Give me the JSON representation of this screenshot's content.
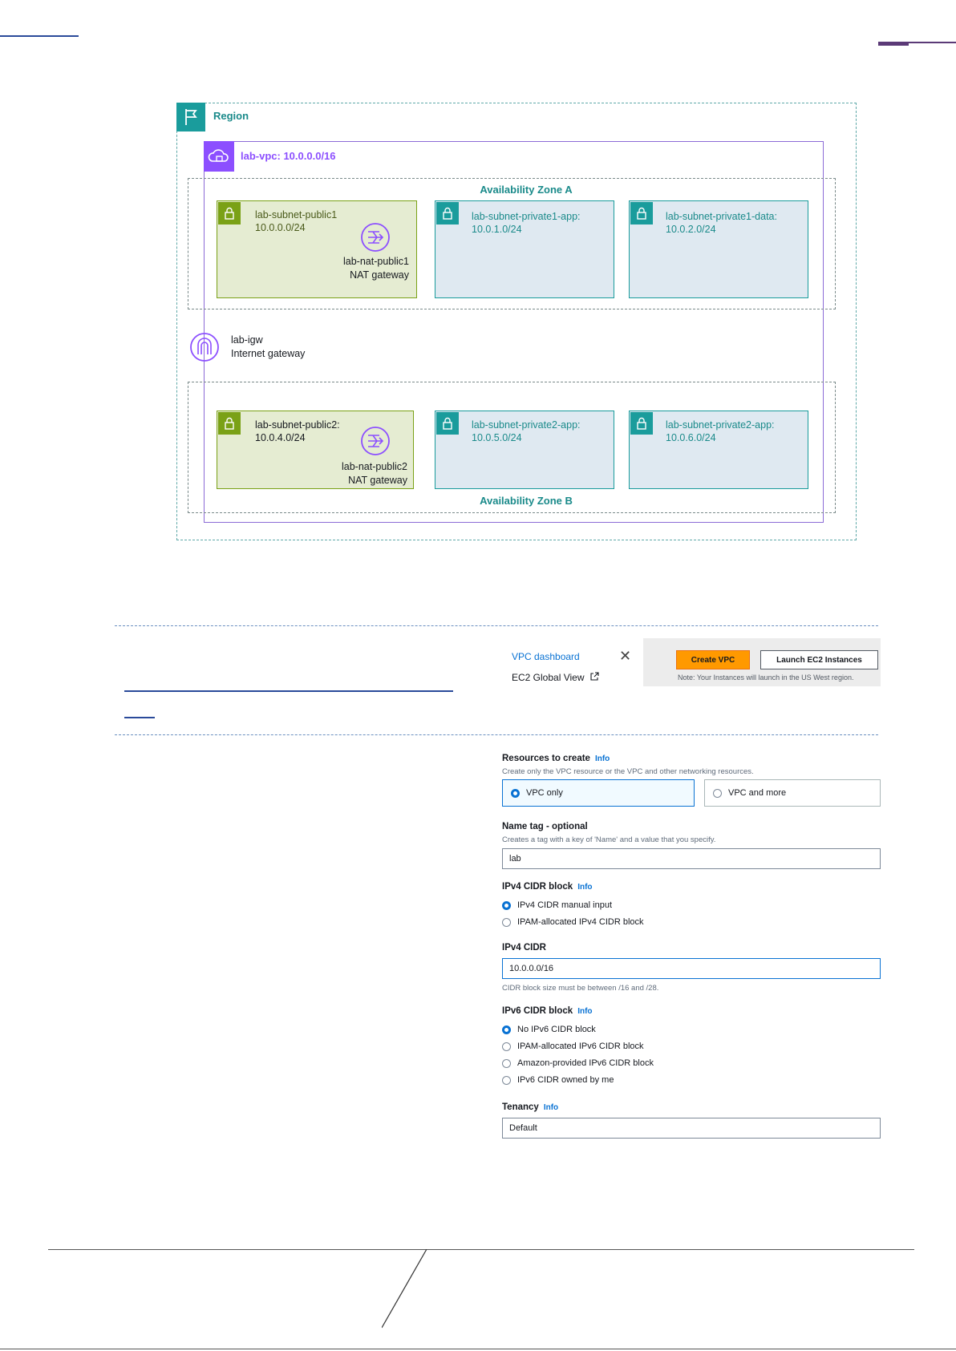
{
  "diagram": {
    "region_label": "Region",
    "vpc_label": "lab-vpc: 10.0.0.0/16",
    "az_a_label": "Availability Zone A",
    "az_b_label": "Availability Zone B",
    "igw": {
      "name": "lab-igw",
      "type": "Internet gateway"
    },
    "zone_a_subnets": [
      {
        "name": "lab-subnet-public1",
        "cidr": "10.0.0.0/24",
        "nat_name": "lab-nat-public1",
        "nat_type": "NAT gateway"
      },
      {
        "name": "lab-subnet-private1-app:",
        "cidr": "10.0.1.0/24"
      },
      {
        "name": "lab-subnet-private1-data:",
        "cidr": "10.0.2.0/24"
      }
    ],
    "zone_b_subnets": [
      {
        "name": "lab-subnet-public2:",
        "cidr": "10.0.4.0/24",
        "nat_name": "lab-nat-public2",
        "nat_type": "NAT gateway"
      },
      {
        "name": "lab-subnet-private2-app:",
        "cidr": "10.0.5.0/24"
      },
      {
        "name": "lab-subnet-private2-app:",
        "cidr": "10.0.6.0/24"
      }
    ],
    "colors": {
      "region": "#1a9c9c",
      "vpc": "#8c4fff",
      "public": "#7aa116",
      "private": "#1a9c9c"
    }
  },
  "nav": {
    "vpc_dashboard": "VPC dashboard",
    "ec2_global_view": "EC2 Global View",
    "close_icon": "close-icon",
    "create_vpc": "Create VPC",
    "launch_ec2": "Launch EC2 Instances",
    "note": "Note: Your Instances will launch in the US West region."
  },
  "form": {
    "resources": {
      "label": "Resources to create",
      "info": "Info",
      "desc": "Create only the VPC resource or the VPC and other networking resources.",
      "options": [
        "VPC only",
        "VPC and more"
      ],
      "selected": "VPC only"
    },
    "name_tag": {
      "label": "Name tag - optional",
      "desc": "Creates a tag with a key of 'Name' and a value that you specify.",
      "value": "lab"
    },
    "ipv4_block": {
      "label": "IPv4 CIDR block",
      "info": "Info",
      "options": [
        "IPv4 CIDR manual input",
        "IPAM-allocated IPv4 CIDR block"
      ],
      "selected": "IPv4 CIDR manual input"
    },
    "ipv4_cidr": {
      "label": "IPv4 CIDR",
      "value": "10.0.0.0/16",
      "hint": "CIDR block size must be between /16 and /28."
    },
    "ipv6_block": {
      "label": "IPv6 CIDR block",
      "info": "Info",
      "options": [
        "No IPv6 CIDR block",
        "IPAM-allocated IPv6 CIDR block",
        "Amazon-provided IPv6 CIDR block",
        "IPv6 CIDR owned by me"
      ],
      "selected": "No IPv6 CIDR block"
    },
    "tenancy": {
      "label": "Tenancy",
      "info": "Info",
      "value": "Default"
    }
  }
}
